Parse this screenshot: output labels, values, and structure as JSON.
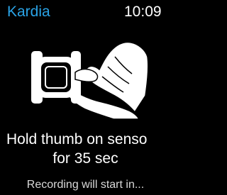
{
  "status_bar": {
    "app_name": "Kardia",
    "time": "10:09",
    "app_name_color": "#2aa3e6"
  },
  "illustration": {
    "icon": "hand-holding-watch-icon"
  },
  "instruction": {
    "line1": "Hold thumb on senso",
    "line2": "for 35 sec",
    "status": "Recording will start in..."
  }
}
